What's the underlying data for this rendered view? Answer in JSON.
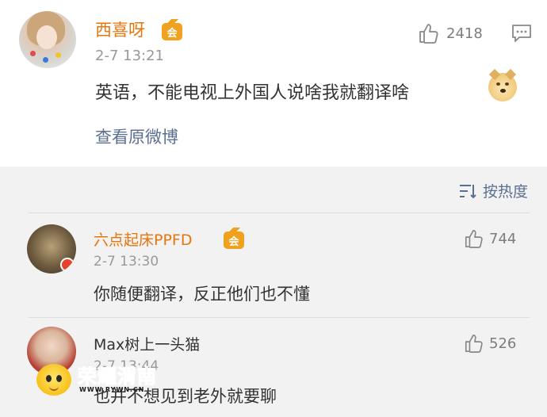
{
  "post": {
    "username": "西喜呀",
    "vip_badge": "会",
    "time": "2-7 13:21",
    "text": "英语，不能电视上外国人说啥我就翻译啥",
    "emoji": "doge-emoji",
    "like_count": "2418",
    "view_original": "查看原微博"
  },
  "sort": {
    "label": "按热度"
  },
  "replies": [
    {
      "username": "六点起床PPFD",
      "vip_badge": "会",
      "time": "2-7 13:30",
      "text": "你随便翻译，反正他们也不懂",
      "like_count": "744",
      "name_color": "#e8750c"
    },
    {
      "username": "Max树上一头猫",
      "time": "2-7 13:44",
      "text": "也并不想见到老外就要聊",
      "like_count": "526",
      "name_color": "#333333"
    }
  ],
  "watermark": {
    "text": "荣耀渭南",
    "url": "WWW.RYWN.CN"
  },
  "colors": {
    "vip_name": "#e8750c",
    "link": "#5b6f93",
    "muted": "#999999"
  }
}
